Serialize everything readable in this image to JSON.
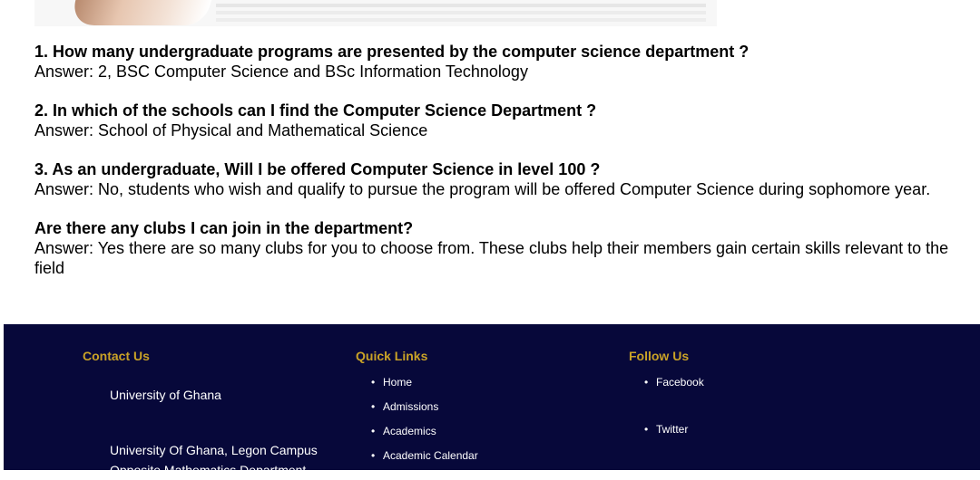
{
  "faq": [
    {
      "q": "1. How many undergraduate programs are presented by the computer science department ?",
      "a": "Answer: 2, BSC Computer Science and BSc Information Technology"
    },
    {
      "q": "2. In which of the schools can I find the Computer Science Department ?",
      "a": "Answer: School of Physical and Mathematical Science"
    },
    {
      "q": "3. As an undergraduate, Will I be offered Computer Science in level 100 ?",
      "a": "Answer: No, students who wish and qualify to pursue the program will be offered Computer Science during sophomore year."
    },
    {
      "q": "Are there any clubs I can join in the department?",
      "a": "Answer: Yes there are so many clubs for you to choose from. These clubs help their members gain certain skills relevant to the field"
    }
  ],
  "footer": {
    "contact": {
      "heading": "Contact Us",
      "line1": "University of Ghana",
      "line2": "University Of Ghana, Legon Campus",
      "line3": "Opposite Mathematics Department"
    },
    "quick_links": {
      "heading": "Quick Links",
      "items": [
        "Home",
        "Admissions",
        "Academics",
        "Academic Calendar"
      ]
    },
    "follow": {
      "heading": "Follow Us",
      "items": [
        "Facebook",
        "Twitter"
      ]
    }
  },
  "colors": {
    "footer_bg": "#07083a",
    "heading_gold": "#c9a227"
  }
}
